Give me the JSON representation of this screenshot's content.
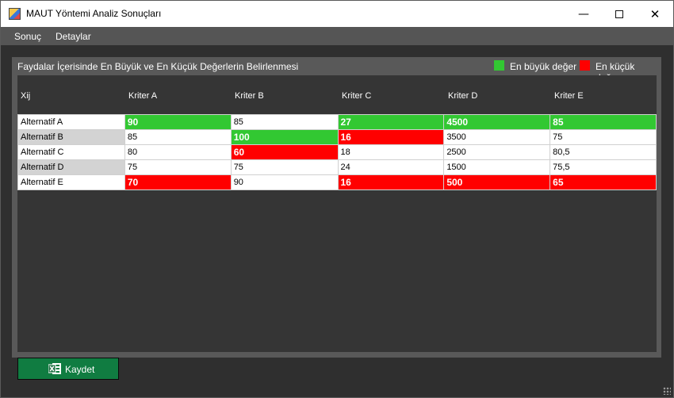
{
  "window": {
    "title": "MAUT Yöntemi Analiz Sonuçları"
  },
  "menu": {
    "items": [
      "Sonuç",
      "Detaylar"
    ]
  },
  "panel": {
    "title": "Faydalar İçerisinde En Büyük ve En Küçük Değerlerin Belirlenmesi",
    "legend": [
      {
        "label": "En büyük değer",
        "color": "#32c832"
      },
      {
        "label": "En küçük değer",
        "color": "#ff0000"
      }
    ]
  },
  "table": {
    "corner": "Xij",
    "columns": [
      "Kriter A",
      "Kriter B",
      "Kriter C",
      "Kriter D",
      "Kriter E"
    ],
    "rows": [
      {
        "label": "Alternatif A",
        "cells": [
          {
            "value": "90",
            "mark": "max"
          },
          {
            "value": "85",
            "mark": ""
          },
          {
            "value": "27",
            "mark": "max"
          },
          {
            "value": "4500",
            "mark": "max"
          },
          {
            "value": "85",
            "mark": "max"
          }
        ]
      },
      {
        "label": "Alternatif B",
        "cells": [
          {
            "value": "85",
            "mark": ""
          },
          {
            "value": "100",
            "mark": "max"
          },
          {
            "value": "16",
            "mark": "min"
          },
          {
            "value": "3500",
            "mark": ""
          },
          {
            "value": "75",
            "mark": ""
          }
        ]
      },
      {
        "label": "Alternatif C",
        "cells": [
          {
            "value": "80",
            "mark": ""
          },
          {
            "value": "60",
            "mark": "min"
          },
          {
            "value": "18",
            "mark": ""
          },
          {
            "value": "2500",
            "mark": ""
          },
          {
            "value": "80,5",
            "mark": ""
          }
        ]
      },
      {
        "label": "Alternatif D",
        "cells": [
          {
            "value": "75",
            "mark": ""
          },
          {
            "value": "75",
            "mark": ""
          },
          {
            "value": "24",
            "mark": ""
          },
          {
            "value": "1500",
            "mark": ""
          },
          {
            "value": "75,5",
            "mark": ""
          }
        ]
      },
      {
        "label": "Alternatif E",
        "cells": [
          {
            "value": "70",
            "mark": "min"
          },
          {
            "value": "90",
            "mark": ""
          },
          {
            "value": "16",
            "mark": "min"
          },
          {
            "value": "500",
            "mark": "min"
          },
          {
            "value": "65",
            "mark": "min"
          }
        ]
      }
    ]
  },
  "actions": {
    "save_label": "Kaydet",
    "save_icon": "excel-icon"
  },
  "colors": {
    "max": "#32c832",
    "min": "#ff0000",
    "save_button": "#107c41"
  }
}
